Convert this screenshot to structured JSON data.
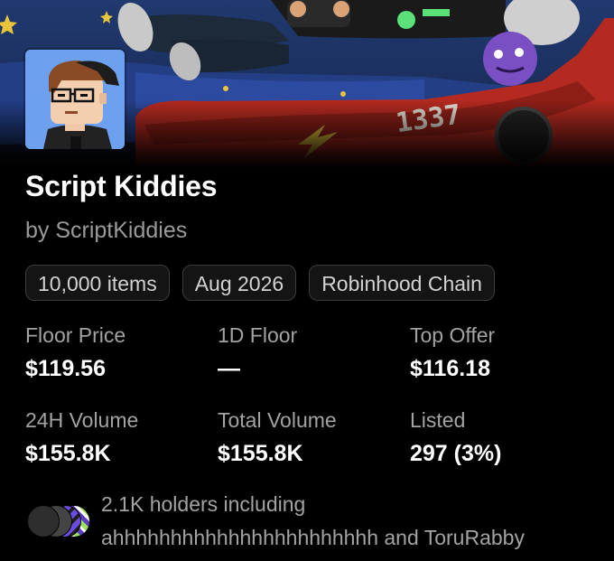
{
  "collection": {
    "name": "Script Kiddies",
    "creator_line": "by ScriptKiddies",
    "banner_text": "1337"
  },
  "chips": [
    {
      "label": "10,000 items"
    },
    {
      "label": "Aug 2026"
    },
    {
      "label": "Robinhood Chain"
    }
  ],
  "stats": {
    "floor_price": {
      "label": "Floor Price",
      "value": "$119.56"
    },
    "one_day_floor": {
      "label": "1D Floor",
      "value": "—"
    },
    "top_offer": {
      "label": "Top Offer",
      "value": "$116.18"
    },
    "volume_24h": {
      "label": "24H Volume",
      "value": "$155.8K"
    },
    "total_volume": {
      "label": "Total Volume",
      "value": "$155.8K"
    },
    "listed": {
      "label": "Listed",
      "value": "297 (3%)"
    }
  },
  "holders": {
    "line1": "2.1K holders including",
    "line2": "ahhhhhhhhhhhhhhhhhhhhhhh and ToruRabby"
  },
  "colors": {
    "background": "#000000",
    "label_gray": "#a3a3a3",
    "chip_border": "#3b3b3b",
    "avatar_bg": "#6da0ee"
  }
}
